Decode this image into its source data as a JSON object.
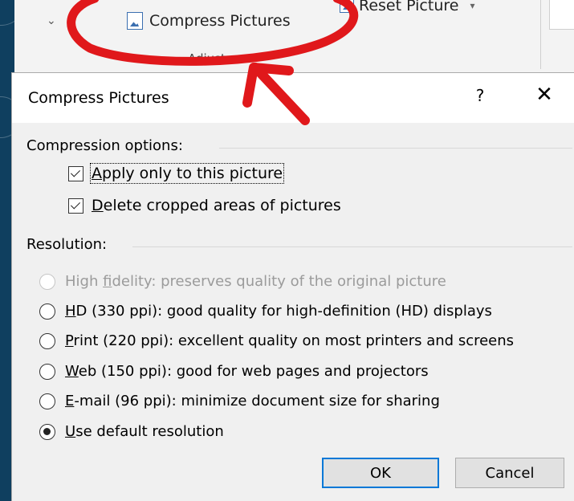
{
  "ribbon": {
    "compress_label": "Compress Pictures",
    "reset_label": "Reset Picture",
    "group_label": "Adjust"
  },
  "dialog": {
    "title": "Compress Pictures",
    "help": "?",
    "close": "✕",
    "compression_section": "Compression options:",
    "apply_only_accel": "A",
    "apply_only_rest": "pply only to this picture",
    "delete_cropped_accel": "D",
    "delete_cropped_rest": "elete cropped areas of pictures",
    "resolution_section": "Resolution:",
    "options": {
      "high_fidelity_pre": "High ",
      "high_fidelity_accel": "f",
      "high_fidelity_rest": "idelity: preserves quality of the original picture",
      "hd_accel": "H",
      "hd_rest": "D (330 ppi): good quality for high-definition (HD) displays",
      "print_accel": "P",
      "print_rest": "rint (220 ppi): excellent quality on most printers and screens",
      "web_accel": "W",
      "web_rest": "eb (150 ppi): good for web pages and projectors",
      "email_accel": "E",
      "email_rest": "-mail (96 ppi): minimize document size for sharing",
      "default_accel": "U",
      "default_rest": "se default resolution"
    },
    "ok_label": "OK",
    "cancel_label": "Cancel"
  },
  "colors": {
    "annotation": "#e0181b",
    "default_button_border": "#0078d7"
  }
}
